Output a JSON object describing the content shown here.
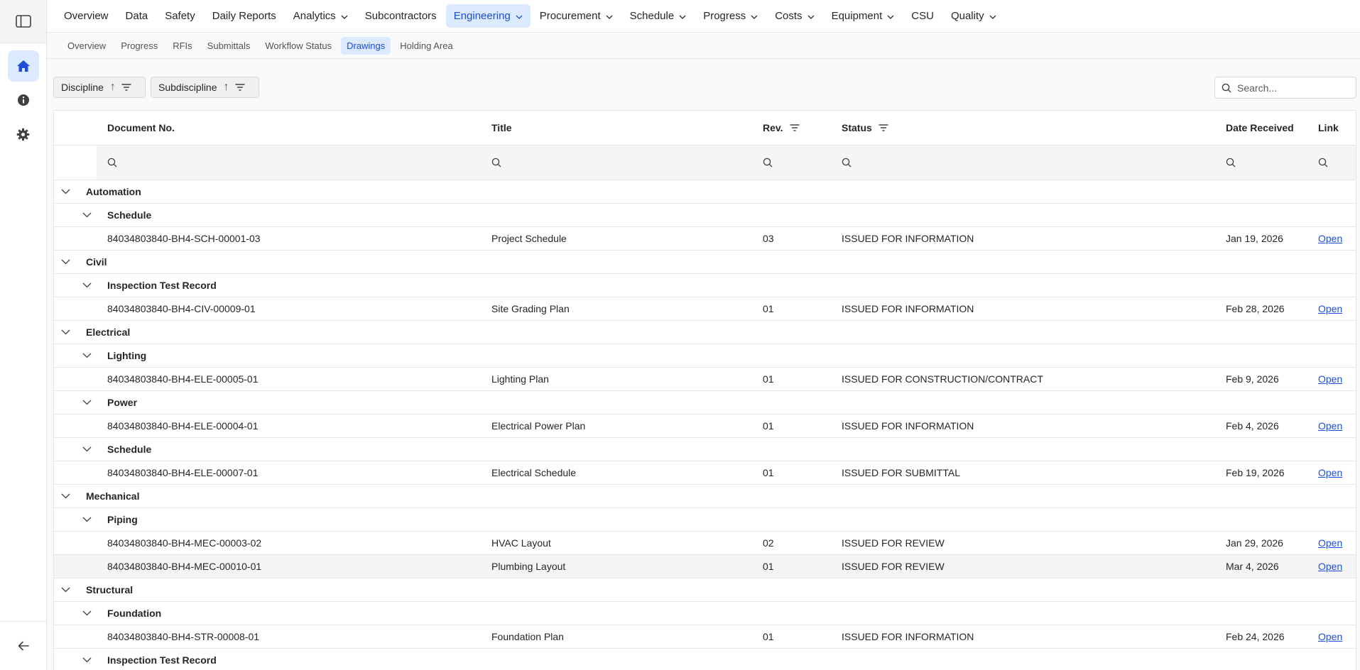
{
  "topnav": [
    {
      "label": "Overview",
      "dropdown": false,
      "active": false
    },
    {
      "label": "Data",
      "dropdown": false,
      "active": false
    },
    {
      "label": "Safety",
      "dropdown": false,
      "active": false
    },
    {
      "label": "Daily Reports",
      "dropdown": false,
      "active": false
    },
    {
      "label": "Analytics",
      "dropdown": true,
      "active": false
    },
    {
      "label": "Subcontractors",
      "dropdown": false,
      "active": false
    },
    {
      "label": "Engineering",
      "dropdown": true,
      "active": true
    },
    {
      "label": "Procurement",
      "dropdown": true,
      "active": false
    },
    {
      "label": "Schedule",
      "dropdown": true,
      "active": false
    },
    {
      "label": "Progress",
      "dropdown": true,
      "active": false
    },
    {
      "label": "Costs",
      "dropdown": true,
      "active": false
    },
    {
      "label": "Equipment",
      "dropdown": true,
      "active": false
    },
    {
      "label": "CSU",
      "dropdown": false,
      "active": false
    },
    {
      "label": "Quality",
      "dropdown": true,
      "active": false
    }
  ],
  "subnav": [
    {
      "label": "Overview",
      "active": false
    },
    {
      "label": "Progress",
      "active": false
    },
    {
      "label": "RFIs",
      "active": false
    },
    {
      "label": "Submittals",
      "active": false
    },
    {
      "label": "Workflow Status",
      "active": false
    },
    {
      "label": "Drawings",
      "active": true
    },
    {
      "label": "Holding Area",
      "active": false
    }
  ],
  "rail": {
    "icons": [
      "sidebar-toggle-icon",
      "home-icon",
      "info-icon",
      "gear-icon",
      "arrow-left-icon"
    ]
  },
  "grouping": {
    "chip1": "Discipline",
    "chip2": "Subdiscipline"
  },
  "search": {
    "placeholder": "Search..."
  },
  "columns": {
    "doc": "Document No.",
    "title": "Title",
    "rev": "Rev.",
    "status": "Status",
    "date": "Date Received",
    "link": "Link"
  },
  "rows": [
    {
      "kind": "g1",
      "label": "Automation"
    },
    {
      "kind": "g2",
      "label": "Schedule"
    },
    {
      "kind": "item",
      "doc": "84034803840-BH4-SCH-00001-03",
      "title": "Project Schedule",
      "rev": "03",
      "status": "ISSUED FOR INFORMATION",
      "date": "Jan 19, 2026",
      "link": "Open"
    },
    {
      "kind": "g1",
      "label": "Civil"
    },
    {
      "kind": "g2",
      "label": "Inspection Test Record"
    },
    {
      "kind": "item",
      "doc": "84034803840-BH4-CIV-00009-01",
      "title": "Site Grading Plan",
      "rev": "01",
      "status": "ISSUED FOR INFORMATION",
      "date": "Feb 28, 2026",
      "link": "Open"
    },
    {
      "kind": "g1",
      "label": "Electrical"
    },
    {
      "kind": "g2",
      "label": "Lighting"
    },
    {
      "kind": "item",
      "doc": "84034803840-BH4-ELE-00005-01",
      "title": "Lighting Plan",
      "rev": "01",
      "status": "ISSUED FOR CONSTRUCTION/CONTRACT",
      "date": "Feb 9, 2026",
      "link": "Open"
    },
    {
      "kind": "g2",
      "label": "Power"
    },
    {
      "kind": "item",
      "doc": "84034803840-BH4-ELE-00004-01",
      "title": "Electrical Power Plan",
      "rev": "01",
      "status": "ISSUED FOR INFORMATION",
      "date": "Feb 4, 2026",
      "link": "Open"
    },
    {
      "kind": "g2",
      "label": "Schedule"
    },
    {
      "kind": "item",
      "doc": "84034803840-BH4-ELE-00007-01",
      "title": "Electrical Schedule",
      "rev": "01",
      "status": "ISSUED FOR SUBMITTAL",
      "date": "Feb 19, 2026",
      "link": "Open"
    },
    {
      "kind": "g1",
      "label": "Mechanical"
    },
    {
      "kind": "g2",
      "label": "Piping"
    },
    {
      "kind": "item",
      "doc": "84034803840-BH4-MEC-00003-02",
      "title": "HVAC Layout",
      "rev": "02",
      "status": "ISSUED FOR REVIEW",
      "date": "Jan 29, 2026",
      "link": "Open"
    },
    {
      "kind": "item",
      "doc": "84034803840-BH4-MEC-00010-01",
      "title": "Plumbing Layout",
      "rev": "01",
      "status": "ISSUED FOR REVIEW",
      "date": "Mar 4, 2026",
      "link": "Open",
      "highlight": true
    },
    {
      "kind": "g1",
      "label": "Structural"
    },
    {
      "kind": "g2",
      "label": "Foundation"
    },
    {
      "kind": "item",
      "doc": "84034803840-BH4-STR-00008-01",
      "title": "Foundation Plan",
      "rev": "01",
      "status": "ISSUED FOR INFORMATION",
      "date": "Feb 24, 2026",
      "link": "Open"
    },
    {
      "kind": "g2",
      "label": "Inspection Test Record"
    }
  ]
}
